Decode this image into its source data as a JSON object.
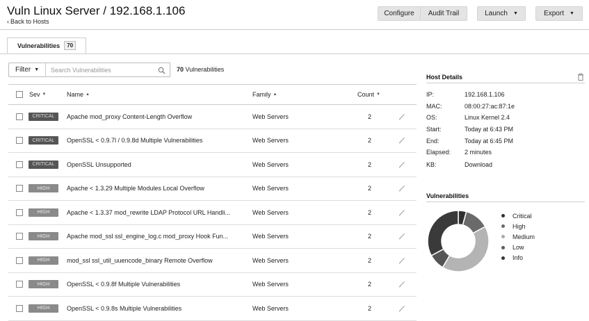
{
  "header": {
    "title": "Vuln Linux Server / 192.168.1.106",
    "back_link": "Back to Hosts",
    "buttons": {
      "configure": "Configure",
      "audit_trail": "Audit Trail",
      "launch": "Launch",
      "export": "Export"
    }
  },
  "tabs": [
    {
      "label": "Vulnerabilities",
      "count": "70"
    }
  ],
  "filter": {
    "label": "Filter",
    "search_placeholder": "Search Vulnerabilities",
    "count_number": "70",
    "count_text": "Vulnerabilities"
  },
  "table": {
    "columns": {
      "sev": "Sev",
      "name": "Name",
      "family": "Family",
      "count": "Count"
    },
    "rows": [
      {
        "sev": "CRITICAL",
        "name": "Apache mod_proxy Content-Length Overflow",
        "family": "Web Servers",
        "count": "2"
      },
      {
        "sev": "CRITICAL",
        "name": "OpenSSL < 0.9.7l / 0.9.8d Multiple Vulnerabilities",
        "family": "Web Servers",
        "count": "2"
      },
      {
        "sev": "CRITICAL",
        "name": "OpenSSL Unsupported",
        "family": "Web Servers",
        "count": "2"
      },
      {
        "sev": "HIGH",
        "name": "Apache < 1.3.29 Multiple Modules Local Overflow",
        "family": "Web Servers",
        "count": "2"
      },
      {
        "sev": "HIGH",
        "name": "Apache < 1.3.37 mod_rewrite LDAP Protocol URL Handli...",
        "family": "Web Servers",
        "count": "2"
      },
      {
        "sev": "HIGH",
        "name": "Apache mod_ssl ssl_engine_log.c mod_proxy Hook Fun...",
        "family": "Web Servers",
        "count": "2"
      },
      {
        "sev": "HIGH",
        "name": "mod_ssl ssl_util_uuencode_binary Remote Overflow",
        "family": "Web Servers",
        "count": "2"
      },
      {
        "sev": "HIGH",
        "name": "OpenSSL < 0.9.8f Multiple Vulnerabilities",
        "family": "Web Servers",
        "count": "2"
      },
      {
        "sev": "HIGH",
        "name": "OpenSSL < 0.9.8s Multiple Vulnerabilities",
        "family": "Web Servers",
        "count": "2"
      }
    ]
  },
  "host_details": {
    "title": "Host Details",
    "fields": [
      {
        "key": "IP:",
        "value": "192.168.1.106"
      },
      {
        "key": "MAC:",
        "value": "08:00:27:ac:87:1e"
      },
      {
        "key": "OS:",
        "value": "Linux Kernel 2.4"
      },
      {
        "key": "Start:",
        "value": "Today at 6:43 PM"
      },
      {
        "key": "End:",
        "value": "Today at 6:45 PM"
      },
      {
        "key": "Elapsed:",
        "value": "2 minutes"
      },
      {
        "key": "KB:",
        "value": "Download"
      }
    ]
  },
  "vulnerabilities_panel": {
    "title": "Vulnerabilities",
    "legend": [
      {
        "label": "Critical",
        "color": "#2f2f2f"
      },
      {
        "label": "High",
        "color": "#6a6a6a"
      },
      {
        "label": "Medium",
        "color": "#a9a9a9"
      },
      {
        "label": "Low",
        "color": "#5a5a5a"
      },
      {
        "label": "Info",
        "color": "#333333"
      }
    ]
  },
  "chart_data": {
    "type": "pie",
    "categories": [
      "Critical",
      "High",
      "Medium",
      "Low",
      "Info"
    ],
    "values": [
      3,
      9,
      29,
      6,
      23
    ],
    "colors": [
      "#2f2f2f",
      "#6a6a6a",
      "#b4b4b4",
      "#555555",
      "#3a3a3a"
    ]
  }
}
